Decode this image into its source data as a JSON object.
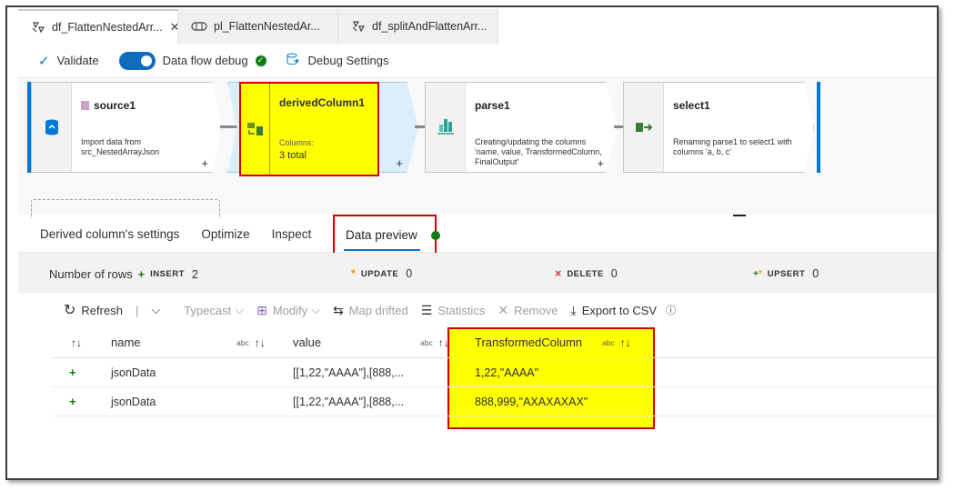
{
  "tabs": [
    {
      "label": "df_FlattenNestedArr...",
      "icon": "dataflow-icon",
      "active": true,
      "close": "✕"
    },
    {
      "label": "pl_FlattenNestedAr...",
      "icon": "pipeline-icon",
      "active": false
    },
    {
      "label": "df_splitAndFlattenArr...",
      "icon": "dataflow-icon",
      "active": false
    }
  ],
  "toolbar": {
    "validate_label": "Validate",
    "debug_label": "Data flow debug",
    "debug_settings_label": "Debug Settings"
  },
  "nodes": {
    "source": {
      "title": "source1",
      "desc": "Import data from src_NestedArrayJson"
    },
    "derived": {
      "title": "derivedColumn1",
      "desc_label": "Columns:",
      "desc_value": "3 total"
    },
    "parse": {
      "title": "parse1",
      "desc": "Creating/updating the columns 'name, value, TransformedColumn, FinalOutput'"
    },
    "select": {
      "title": "select1",
      "desc": "Renaming parse1 to select1 with columns 'a, b, c'"
    }
  },
  "subtabs": [
    "Derived column's settings",
    "Optimize",
    "Inspect",
    "Data preview"
  ],
  "counters": {
    "label": "Number of rows",
    "insert": {
      "label": "INSERT",
      "value": "2"
    },
    "update": {
      "label": "UPDATE",
      "value": "0"
    },
    "delete": {
      "label": "DELETE",
      "value": "0"
    },
    "upsert": {
      "label": "UPSERT",
      "value": "0"
    }
  },
  "preview_toolbar": {
    "refresh": "Refresh",
    "typecast": "Typecast",
    "modify": "Modify",
    "map_drifted": "Map drifted",
    "statistics": "Statistics",
    "remove": "Remove",
    "export": "Export to CSV"
  },
  "table": {
    "columns": [
      {
        "name": "name",
        "type": "abc"
      },
      {
        "name": "value",
        "type": "abc"
      },
      {
        "name": "TransformedColumn",
        "type": "abc"
      }
    ],
    "rows": [
      {
        "name": "jsonData",
        "value": "[[1,22,\"AAAA\"],[888,...",
        "transformed": "1,22,\"AAAA\""
      },
      {
        "name": "jsonData",
        "value": "[[1,22,\"AAAA\"],[888,...",
        "transformed": "888,999,\"AXAXAXAX\""
      }
    ]
  },
  "colors": {
    "accent": "#0078d4",
    "highlight": "#ffff00",
    "annotation": "#d40000",
    "success": "#107c10"
  }
}
